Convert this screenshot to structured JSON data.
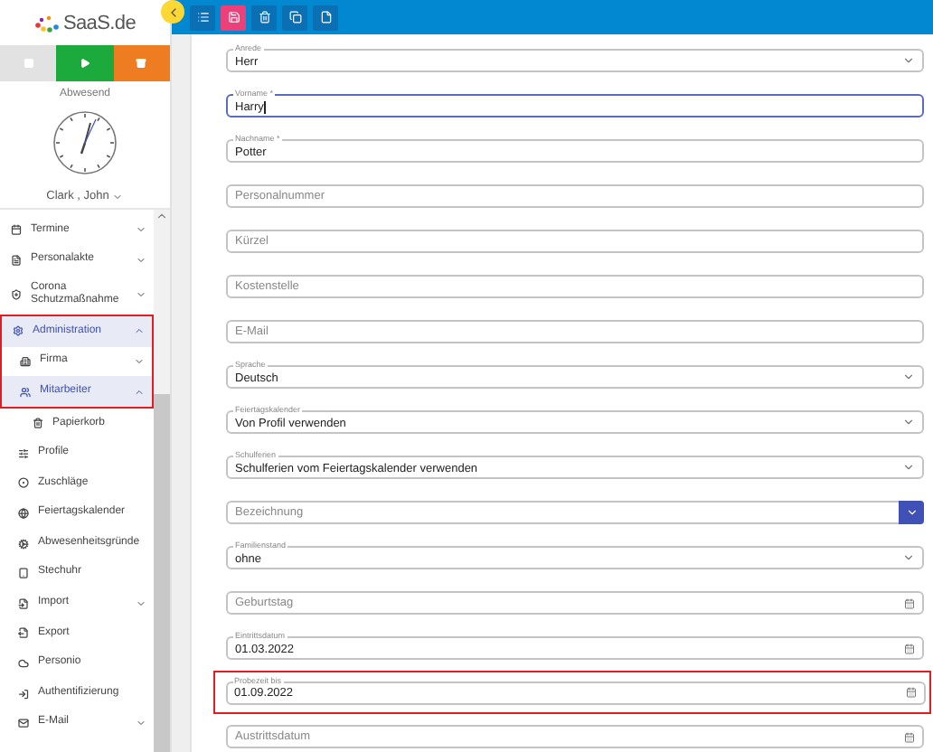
{
  "logo": {
    "text": "SaaS.de"
  },
  "status_buttons": [
    {
      "color": "#e2e2e2"
    },
    {
      "color": "#1caa3c"
    },
    {
      "color": "#ee7d22"
    }
  ],
  "status": "Abwesend",
  "user": {
    "name": "Clark , John",
    "expanded": false
  },
  "menu": [
    {
      "label": "Termine",
      "expanded": false,
      "selected": false,
      "marked": false
    },
    {
      "label": "Personalakte",
      "expanded": false,
      "selected": false,
      "marked": false
    },
    {
      "label": "Corona Schutzmaßnahme",
      "expanded": false,
      "selected": false,
      "marked": false
    },
    {
      "label": "Administration",
      "expanded": true,
      "selected": true,
      "marked": true,
      "children": [
        {
          "label": "Firma",
          "expanded": false,
          "selected": false,
          "marked": true
        },
        {
          "label": "Mitarbeiter",
          "expanded": true,
          "selected": true,
          "marked": true,
          "children": [
            {
              "label": "Papierkorb",
              "selected": false,
              "marked": false
            }
          ]
        },
        {
          "label": "Profile",
          "selected": false,
          "marked": false
        },
        {
          "label": "Zuschläge",
          "selected": false,
          "marked": false
        },
        {
          "label": "Feiertagskalender",
          "selected": false,
          "marked": false
        },
        {
          "label": "Abwesenheitsgründe",
          "selected": false,
          "marked": false
        },
        {
          "label": "Stechuhr",
          "selected": false,
          "marked": false
        },
        {
          "label": "Import",
          "expanded": false,
          "selected": false,
          "marked": false
        },
        {
          "label": "Export",
          "selected": false,
          "marked": false
        },
        {
          "label": "Personio",
          "selected": false,
          "marked": false
        },
        {
          "label": "Authentifizierung",
          "selected": false,
          "marked": false
        },
        {
          "label": "E-Mail",
          "expanded": false,
          "selected": false,
          "marked": false
        }
      ]
    }
  ],
  "toolbar": [
    {
      "color": "#0a6fb3"
    },
    {
      "color": "#ec407a"
    },
    {
      "color": "#0a6fb3"
    },
    {
      "color": "#0a6fb3"
    },
    {
      "color": "#0a6fb3"
    }
  ],
  "form": {
    "fields": [
      {
        "kind": "select",
        "label": "Anrede",
        "value": "Herr",
        "focused": false,
        "highlighted": false
      },
      {
        "kind": "text",
        "label": "Vorname *",
        "value": "Harry",
        "focused": true,
        "highlighted": false
      },
      {
        "kind": "text",
        "label": "Nachname *",
        "value": "Potter",
        "focused": false,
        "highlighted": false
      },
      {
        "kind": "text",
        "placeholder": "Personalnummer",
        "focused": false,
        "highlighted": false
      },
      {
        "kind": "text",
        "placeholder": "Kürzel",
        "focused": false,
        "highlighted": false
      },
      {
        "kind": "text",
        "placeholder": "Kostenstelle",
        "focused": false,
        "highlighted": false
      },
      {
        "kind": "text",
        "placeholder": "E-Mail",
        "focused": false,
        "highlighted": false
      },
      {
        "kind": "select",
        "label": "Sprache",
        "value": "Deutsch",
        "focused": false,
        "highlighted": false
      },
      {
        "kind": "select",
        "label": "Feiertagskalender",
        "value": "Von Profil verwenden",
        "focused": false,
        "highlighted": false
      },
      {
        "kind": "select",
        "label": "Schulferien",
        "value": "Schulferien vom Feiertagskalender verwenden",
        "focused": false,
        "highlighted": false
      },
      {
        "kind": "dropdown-button",
        "placeholder": "Bezeichnung",
        "focused": false,
        "highlighted": false
      },
      {
        "kind": "select",
        "label": "Familienstand",
        "value": "ohne",
        "focused": false,
        "highlighted": false
      },
      {
        "kind": "date",
        "placeholder": "Geburtstag",
        "focused": false,
        "highlighted": false
      },
      {
        "kind": "date",
        "label": "Eintrittsdatum",
        "value": "01.03.2022",
        "focused": false,
        "highlighted": false
      },
      {
        "kind": "date",
        "label": "Probezeit bis",
        "value": "01.09.2022",
        "focused": false,
        "highlighted": true
      },
      {
        "kind": "date",
        "placeholder": "Austrittsdatum",
        "focused": false,
        "highlighted": false
      }
    ]
  }
}
